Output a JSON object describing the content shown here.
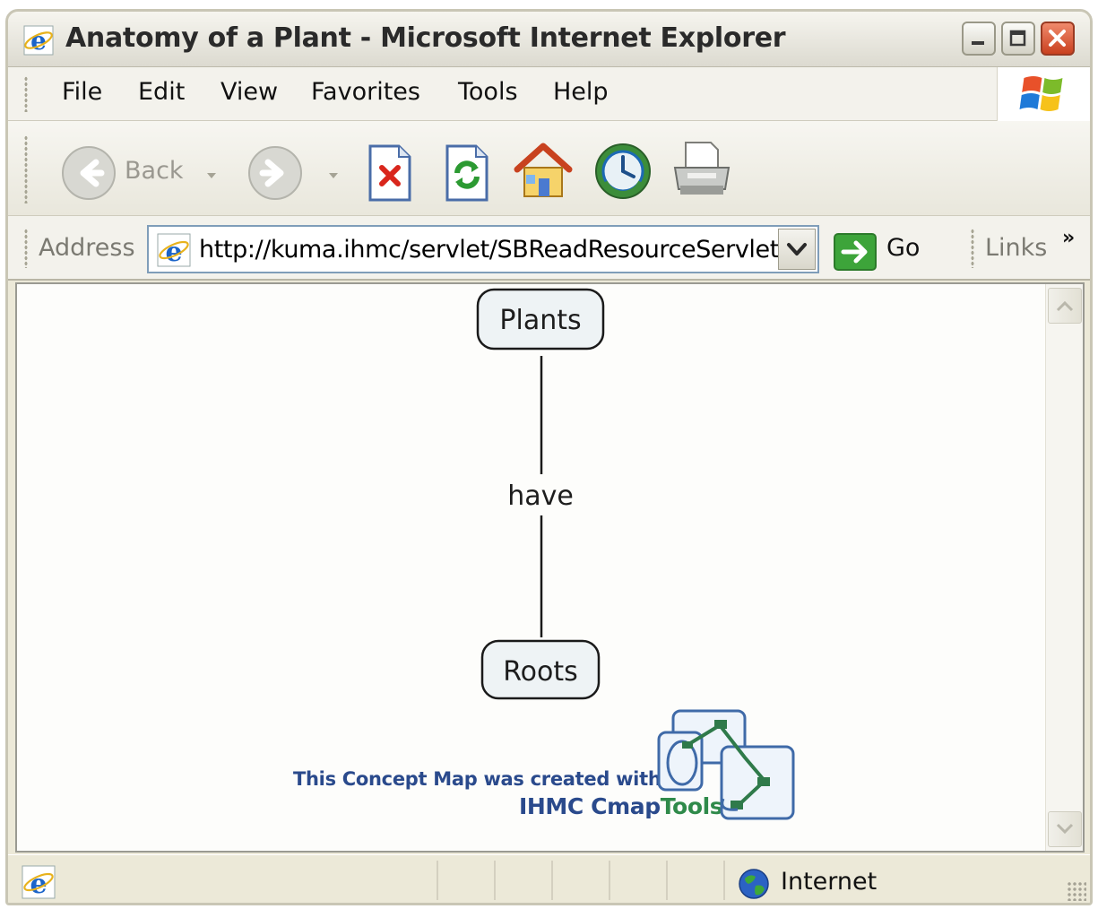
{
  "window": {
    "title": "Anatomy of a Plant - Microsoft Internet Explorer"
  },
  "menu": {
    "items": [
      "File",
      "Edit",
      "View",
      "Favorites",
      "Tools",
      "Help"
    ]
  },
  "toolbar": {
    "back_label": "Back",
    "icons": [
      "back-icon",
      "forward-icon",
      "stop-icon",
      "refresh-icon",
      "home-icon",
      "media-icon",
      "print-icon"
    ]
  },
  "address_bar": {
    "label": "Address",
    "url": "http://kuma.ihmc/servlet/SBReadResourceServlet",
    "go_label": "Go",
    "links_label": "Links",
    "chevron": "»"
  },
  "concept_map": {
    "nodes": [
      "Plants",
      "Roots"
    ],
    "linking_phrase": "have",
    "credit": {
      "line1": "This Concept Map was created with",
      "brand": "IHMC Cmap",
      "brand_accent": "Tools"
    }
  },
  "status_bar": {
    "zone": "Internet"
  },
  "colors": {
    "title_bar": "#dcdad0",
    "content_bg": "#fdfdfb",
    "node_fill": "#eef3f5",
    "credit_blue": "#2a4a8c",
    "credit_green": "#2f8a4a"
  }
}
